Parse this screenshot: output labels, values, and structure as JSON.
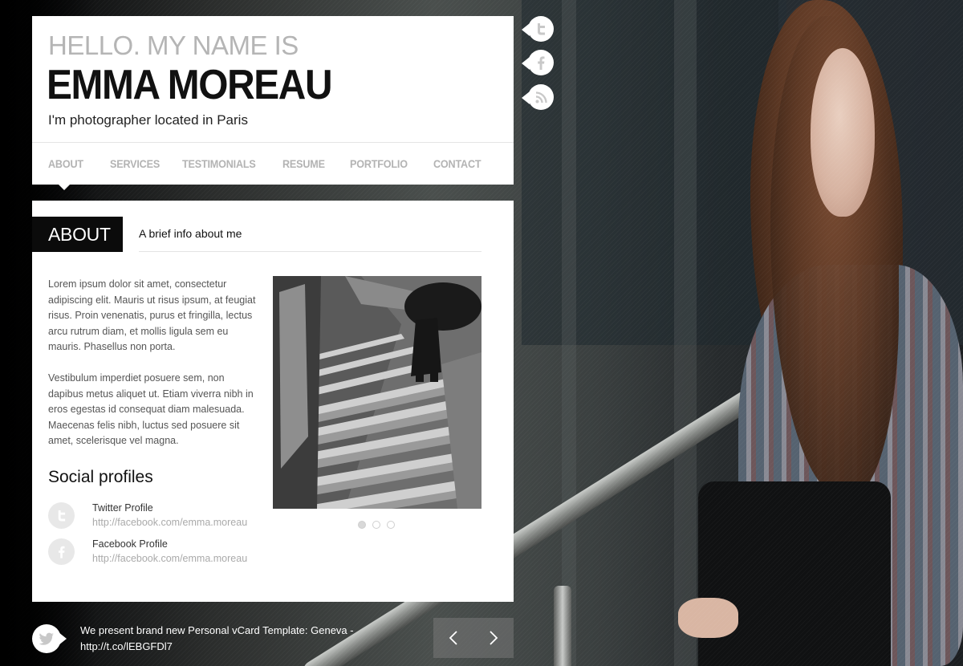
{
  "header": {
    "hello": "HELLO. MY NAME IS",
    "name": "EMMA MOREAU",
    "tagline": "I'm photographer located in Paris"
  },
  "nav": {
    "items": [
      "ABOUT",
      "SERVICES",
      "TESTIMONIALS",
      "RESUME",
      "PORTFOLIO",
      "CONTACT"
    ],
    "active": "ABOUT"
  },
  "share_icons": [
    "twitter-icon",
    "facebook-icon",
    "rss-icon"
  ],
  "about": {
    "section_title": "ABOUT",
    "section_subtitle": "A brief info about me",
    "paragraphs": [
      "Lorem ipsum dolor sit amet, consectetur adipiscing elit. Mauris ut risus ipsum, at feugiat risus. Proin venenatis, purus et fringilla, lectus arcu rutrum diam, et mollis ligula sem eu mauris. Phasellus non porta.",
      "Vestibulum imperdiet posuere sem, non dapibus metus aliquet ut. Etiam viverra nibh in eros egestas id consequat diam malesuada. Maecenas felis nibh, luctus sed posuere sit amet, scelerisque vel magna."
    ],
    "social_title": "Social profiles",
    "profiles": [
      {
        "label": "Twitter Profile",
        "url": "http://facebook.com/emma.moreau",
        "icon": "twitter-icon"
      },
      {
        "label": "Facebook Profile",
        "url": "http://facebook.com/emma.moreau",
        "icon": "facebook-icon"
      }
    ],
    "slider": {
      "slides": 3,
      "active": 1
    }
  },
  "footer": {
    "tweet_text": "We present brand new Personal vCard Template: Geneva -",
    "tweet_link": "http://t.co/lEBGFDl7",
    "prev_icon": "chevron-left-icon",
    "next_icon": "chevron-right-icon"
  },
  "colors": {
    "card_bg": "#ffffff",
    "section_tag_bg": "#0b0b0b",
    "nav_text": "#b3b3b3",
    "name_text": "#111111"
  }
}
